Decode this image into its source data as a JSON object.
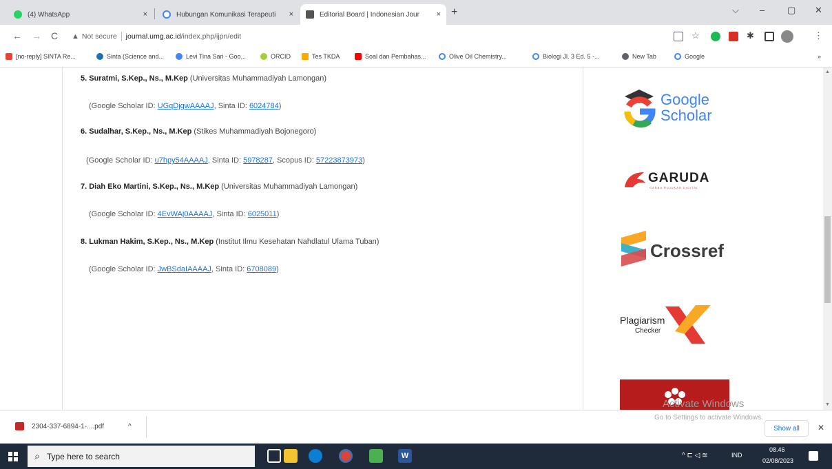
{
  "tabs": [
    {
      "title": "(4) WhatsApp",
      "close": "×"
    },
    {
      "title": "Hubungan Komunikasi Terapeuti",
      "close": "×"
    },
    {
      "title": "Editorial Board | Indonesian Jour",
      "close": "×"
    }
  ],
  "new_tab": "+",
  "window_controls": {
    "dropdown": "⌵",
    "minimize": "–",
    "maximize": "▢",
    "close": "✕"
  },
  "nav": {
    "back": "←",
    "forward": "→",
    "reload": "C"
  },
  "address": {
    "security": "Not secure",
    "domain": "journal.umg.ac.id",
    "path": "/index.php/ijpn/edit"
  },
  "bookmarks": [
    "[no-reply] SINTA Re...",
    "Sinta (Science and...",
    "Levi Tina Sari - Goo...",
    "ORCID",
    "Tes TKDA",
    "Soal dan Pembahas...",
    "Olive Oil Chemistry...",
    "Biologi Jl. 3 Ed. 5 -...",
    "New Tab",
    "Google"
  ],
  "bookmarks_more": "»",
  "members": [
    {
      "name": "5. Suratmi, S.Kep., Ns., M.Kep",
      "affiliation": " (Universitas Muhammadiyah Lamongan)",
      "gs_prefix": "(Google Scholar ID: ",
      "gs_id": "UGqDjgwAAAAJ",
      "sinta_prefix": ", Sinta ID: ",
      "sinta_id": "6024784",
      "scopus_prefix": "",
      "scopus_id": "",
      "suffix": ")"
    },
    {
      "name": "6. Sudalhar, S.Kep., Ns., M.Kep",
      "affiliation": " (Stikes Muhammadiyah Bojonegoro)",
      "gs_prefix": "(Google Scholar ID: ",
      "gs_id": "u7hpy54AAAAJ",
      "sinta_prefix": ", Sinta ID: ",
      "sinta_id": "5978287",
      "scopus_prefix": ", Scopus ID: ",
      "scopus_id": "57223873973",
      "suffix": ")"
    },
    {
      "name": "7. Diah Eko Martini, S.Kep., Ns., M.Kep",
      "affiliation": " (Universitas Muhammadiyah Lamongan)",
      "gs_prefix": "(Google Scholar ID: ",
      "gs_id": "4EvWAj0AAAAJ",
      "sinta_prefix": ", Sinta ID: ",
      "sinta_id": "6025011",
      "scopus_prefix": "",
      "scopus_id": "",
      "suffix": ")"
    },
    {
      "name": "8. Lukman Hakim, S.Kep., Ns., M.Kep",
      "affiliation": " (Institut Ilmu Kesehatan Nahdlatul Ulama Tuban)",
      "gs_prefix": "(Google Scholar ID: ",
      "gs_id": "JwBSdaIAAAAJ",
      "sinta_prefix": ", Sinta ID: ",
      "sinta_id": "6708089",
      "scopus_prefix": "",
      "scopus_id": "",
      "suffix": ")"
    }
  ],
  "logos": {
    "google_scholar": {
      "line1": "Google",
      "line2": "Scholar"
    },
    "garuda": {
      "name": "GARUDA",
      "tagline": "GARBA RUJUKAN DIGITAL"
    },
    "crossref": {
      "name": "Crossref"
    },
    "plagiarism": {
      "line1": "Plagiarism",
      "line2": "Checker"
    }
  },
  "watermark": {
    "line1": "Activate Windows",
    "line2": "Go to Settings to activate Windows."
  },
  "download": {
    "filename": "2304-337-6894-1-....pdf",
    "expand": "^",
    "show_all": "Show all",
    "close": "✕"
  },
  "taskbar": {
    "search_placeholder": "Type here to search",
    "lang": "IND",
    "time": "08.46",
    "date": "02/08/2023"
  },
  "colors": {
    "accent": "#1a73e8",
    "taskbar": "#1f2a3a",
    "tabstrip": "#dfe1e5"
  }
}
